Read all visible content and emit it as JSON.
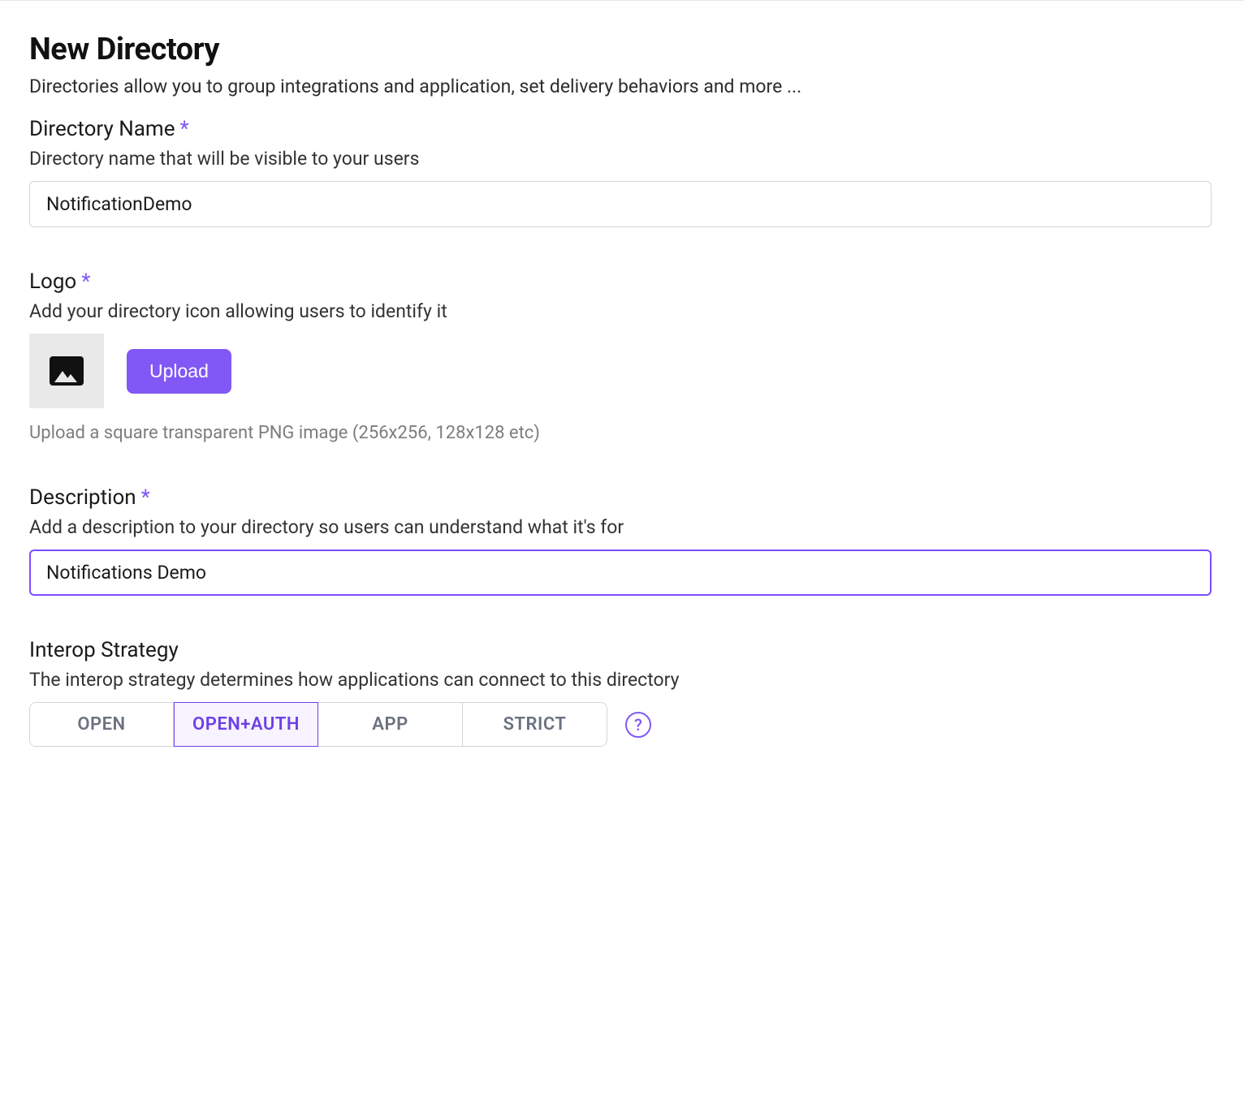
{
  "page": {
    "title": "New Directory",
    "subtitle": "Directories allow you to group integrations and application, set delivery behaviors and more ..."
  },
  "directory_name": {
    "label": "Directory Name",
    "desc": "Directory name that will be visible to your users",
    "value": "NotificationDemo"
  },
  "logo": {
    "label": "Logo",
    "desc": "Add your directory icon allowing users to identify it",
    "upload_label": "Upload",
    "hint": "Upload a square transparent PNG image (256x256, 128x128 etc)"
  },
  "description": {
    "label": "Description",
    "desc": "Add a description to your directory so users can understand what it's for",
    "value": "Notifications Demo"
  },
  "interop": {
    "label": "Interop Strategy",
    "desc": "The interop strategy determines how applications can connect to this directory",
    "options": [
      "OPEN",
      "OPEN+AUTH",
      "APP",
      "STRICT"
    ],
    "selected": "OPEN+AUTH"
  },
  "symbols": {
    "asterisk": "*",
    "question": "?"
  },
  "colors": {
    "accent": "#8158f5"
  }
}
